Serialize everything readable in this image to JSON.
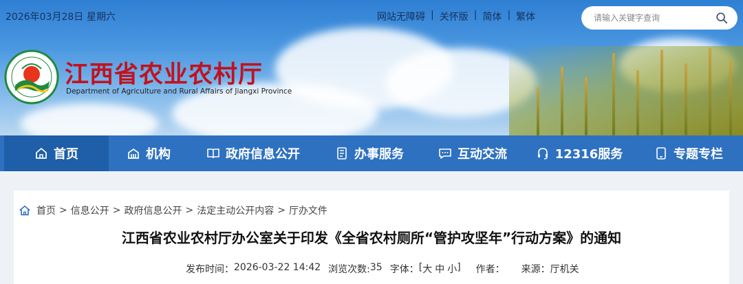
{
  "topbar": {
    "date": "2026年03月28日",
    "weekday": "星期六",
    "links": [
      "网站无障碍",
      "关怀版",
      "简体",
      "繁体"
    ],
    "separator": "|"
  },
  "search": {
    "placeholder": "请输入关键字查询"
  },
  "header": {
    "title": "江西省农业农村厅",
    "subtitle": "Department of Agriculture and Rural Affairs of Jiangxi Province",
    "title_color": "#c1121f"
  },
  "nav": {
    "items": [
      {
        "label": "首页",
        "icon": "home-icon"
      },
      {
        "label": "机构",
        "icon": "building-icon"
      },
      {
        "label": "政府信息公开",
        "icon": "book-icon"
      },
      {
        "label": "办事服务",
        "icon": "document-icon"
      },
      {
        "label": "互动交流",
        "icon": "chat-icon"
      },
      {
        "label": "12316服务",
        "icon": "headset-icon"
      },
      {
        "label": "专题专栏",
        "icon": "tablet-icon"
      }
    ],
    "bg_color": "#2e71c1",
    "active_color": "#1f5ea8"
  },
  "breadcrumb": {
    "items": [
      "首页",
      "信息公开",
      "政府信息公开",
      "法定主动公开内容",
      "厅办文件"
    ],
    "arrow": ">"
  },
  "article": {
    "title": "江西省农业农村厅办公室关于印发《全省农村厕所“管护攻坚年”行动方案》的通知",
    "publish_label": "发布时间：",
    "publish_time": "2026-03-22 14:42",
    "views_label": "浏览次数:",
    "views": "35",
    "font_label": "字体：",
    "font_open": "[",
    "font_large": "大",
    "font_medium": "中",
    "font_small": "小",
    "font_close": "]",
    "author_label": "作者：",
    "author": "",
    "source_label": "来源：",
    "source": "厅机关"
  }
}
